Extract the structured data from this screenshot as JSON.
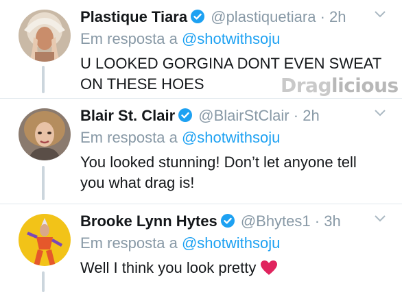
{
  "reply_prefix": "Em resposta a",
  "watermark": "Draglicious",
  "colors": {
    "link": "#1da1f2",
    "muted": "#8899a6",
    "verified": "#1da1f2",
    "heart": "#e0245e"
  },
  "tweets": [
    {
      "name": "Plastique Tiara",
      "handle": "@plastiquetiara",
      "dot": "·",
      "time": "2h",
      "reply_to": "@shotwithsoju",
      "text": "U LOOKED GORGINA DONT EVEN SWEAT ON THESE HOES",
      "avatar_icon": "avatar-plastique-tiara"
    },
    {
      "name": "Blair St. Clair",
      "handle": "@BlairStClair",
      "dot": "·",
      "time": "2h",
      "reply_to": "@shotwithsoju",
      "text": "You looked stunning! Don’t let anyone tell you what drag is!",
      "avatar_icon": "avatar-blair-st-clair"
    },
    {
      "name": "Brooke Lynn Hytes",
      "handle": "@Bhytes1",
      "dot": "·",
      "time": "3h",
      "reply_to": "@shotwithsoju",
      "text": "Well I think you look pretty",
      "emoji": "red-heart-icon",
      "avatar_icon": "avatar-brooke-lynn-hytes"
    }
  ]
}
